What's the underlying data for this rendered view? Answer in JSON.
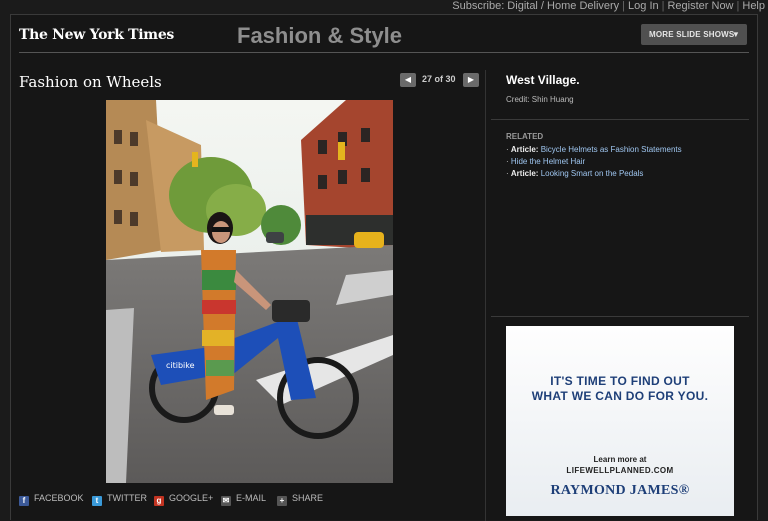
{
  "topbar": {
    "subscribe": "Subscribe: Digital / Home Delivery",
    "login": "Log In",
    "register": "Register Now",
    "help": "Help",
    "separator": "|"
  },
  "header": {
    "logo": "The New York Times",
    "section": "Fashion & Style",
    "more_slideshows": "MORE SLIDE SHOWS",
    "more_caret": "▼"
  },
  "slideshow": {
    "title": "Fashion on Wheels",
    "prev": "◀",
    "next": "▶",
    "counter": "27 of 30",
    "photo_label": "citibike"
  },
  "share": [
    {
      "label": "FACEBOOK",
      "icon": "facebook-icon",
      "glyph": "f",
      "color": "#3b5998"
    },
    {
      "label": "TWITTER",
      "icon": "twitter-icon",
      "glyph": "t",
      "color": "#3a9ad9"
    },
    {
      "label": "GOOGLE+",
      "icon": "google-plus-icon",
      "glyph": "g",
      "color": "#c23321"
    },
    {
      "label": "E-MAIL",
      "icon": "email-icon",
      "glyph": "✉",
      "color": "#555555"
    },
    {
      "label": "SHARE",
      "icon": "share-icon",
      "glyph": "+",
      "color": "#555555"
    }
  ],
  "sidebar": {
    "caption": "West Village.",
    "credit": "Credit: Shin Huang",
    "related_heading": "RELATED",
    "related": [
      {
        "prefix": "Article:",
        "text": "Bicycle Helmets as Fashion Statements"
      },
      {
        "prefix": "",
        "text": "Hide the Helmet Hair"
      },
      {
        "prefix": "Article:",
        "text": "Looking Smart on the Pedals"
      }
    ]
  },
  "ad": {
    "headline_1": "IT'S TIME TO FIND OUT",
    "headline_2": "WHAT WE CAN DO FOR YOU.",
    "learn": "Learn more at",
    "url": "LIFEWELLPLANNED.COM",
    "brand": "RAYMOND JAMES®"
  }
}
